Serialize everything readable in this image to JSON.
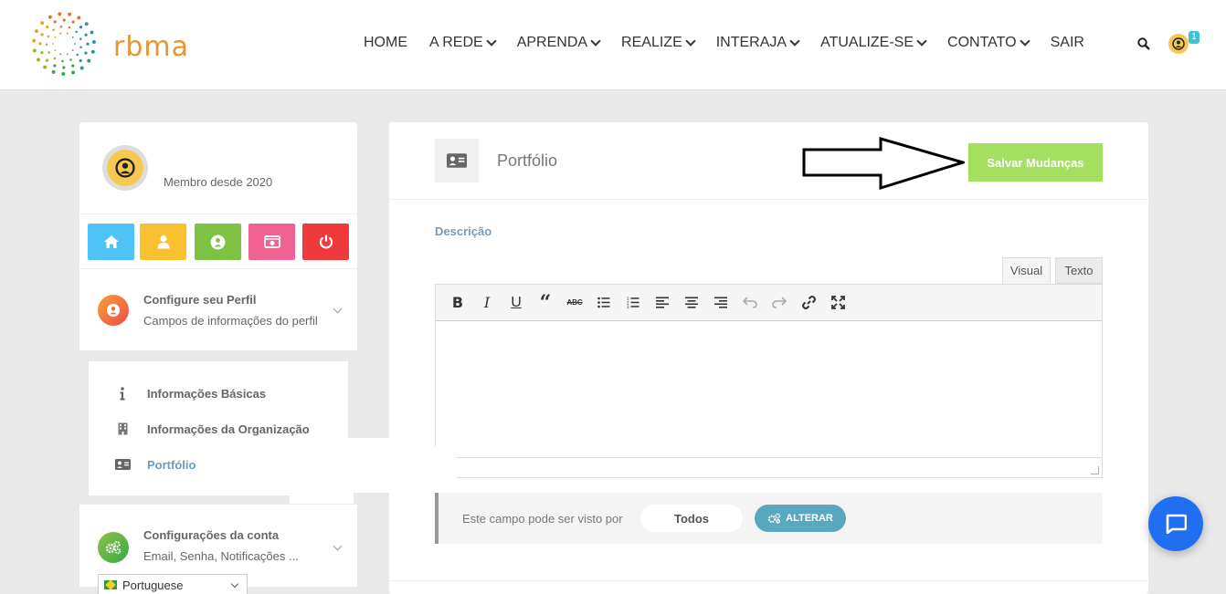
{
  "brand": {
    "name": "rbma",
    "accent": "#e69535"
  },
  "nav": {
    "items": [
      {
        "label": "HOME",
        "dropdown": false
      },
      {
        "label": "A REDE",
        "dropdown": true
      },
      {
        "label": "APRENDA",
        "dropdown": true
      },
      {
        "label": "REALIZE",
        "dropdown": true
      },
      {
        "label": "INTERAJA",
        "dropdown": true
      },
      {
        "label": "ATUALIZE-SE",
        "dropdown": true
      },
      {
        "label": "CONTATO",
        "dropdown": true
      },
      {
        "label": "SAIR",
        "dropdown": false
      }
    ],
    "notification_count": "1"
  },
  "profile": {
    "member_since": "Membro desde 2020"
  },
  "quick_actions": [
    {
      "icon": "home-icon",
      "color": "#4fc3f7"
    },
    {
      "icon": "user-icon",
      "color": "#f9c02f"
    },
    {
      "icon": "user-circle-icon",
      "color": "#7dc242"
    },
    {
      "icon": "photo-icon",
      "color": "#f06292"
    },
    {
      "icon": "power-icon",
      "color": "#f0393b"
    }
  ],
  "sections": {
    "profile_config": {
      "title": "Configure seu Perfil",
      "subtitle": "Campos de informações do perfil"
    },
    "submenu": [
      {
        "label": "Informações Básicas",
        "icon": "info-icon",
        "active": false
      },
      {
        "label": "Informações da Organização",
        "icon": "building-icon",
        "active": false
      },
      {
        "label": "Portfólio",
        "icon": "id-card-icon",
        "active": true
      }
    ],
    "account_config": {
      "title": "Configurações da conta",
      "subtitle": "Email, Senha, Notificações ..."
    }
  },
  "language": {
    "selected": "Portuguese"
  },
  "main": {
    "title": "Portfólio",
    "save_label": "Salvar Mudanças",
    "field_label": "Descrição",
    "tabs": {
      "visual": "Visual",
      "text": "Texto"
    },
    "toolbar_icons": [
      "bold-icon",
      "italic-icon",
      "underline-icon",
      "blockquote-icon",
      "strikethrough-icon",
      "bullet-list-icon",
      "numbered-list-icon",
      "align-left-icon",
      "align-center-icon",
      "align-right-icon",
      "undo-icon",
      "redo-icon",
      "link-icon",
      "fullscreen-icon"
    ],
    "visibility": {
      "text": "Este campo pode ser visto por",
      "value": "Todos",
      "change_label": "ALTERAR"
    }
  }
}
